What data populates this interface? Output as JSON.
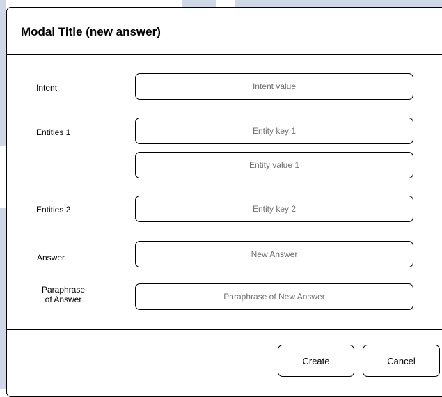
{
  "modal": {
    "title": "Modal Title (new answer)"
  },
  "form": {
    "intent": {
      "label": "Intent",
      "placeholder": "Intent value",
      "value": ""
    },
    "entities_1": {
      "label": "Entities 1",
      "key_placeholder": "Entity key 1",
      "value_placeholder": "Entity value 1"
    },
    "entities_2": {
      "label": "Entities 2",
      "key_placeholder": "Entity key 2"
    },
    "answer": {
      "label": "Answer",
      "placeholder": "New Answer"
    },
    "paraphrase": {
      "label_line1": "Paraphrase",
      "label_line2": "of Answer",
      "placeholder": "Paraphrase of New Answer"
    }
  },
  "footer": {
    "create_label": "Create",
    "cancel_label": "Cancel"
  },
  "colors": {
    "background_accent": "#cfd8e6",
    "border": "#000000",
    "placeholder_text": "#707070"
  }
}
